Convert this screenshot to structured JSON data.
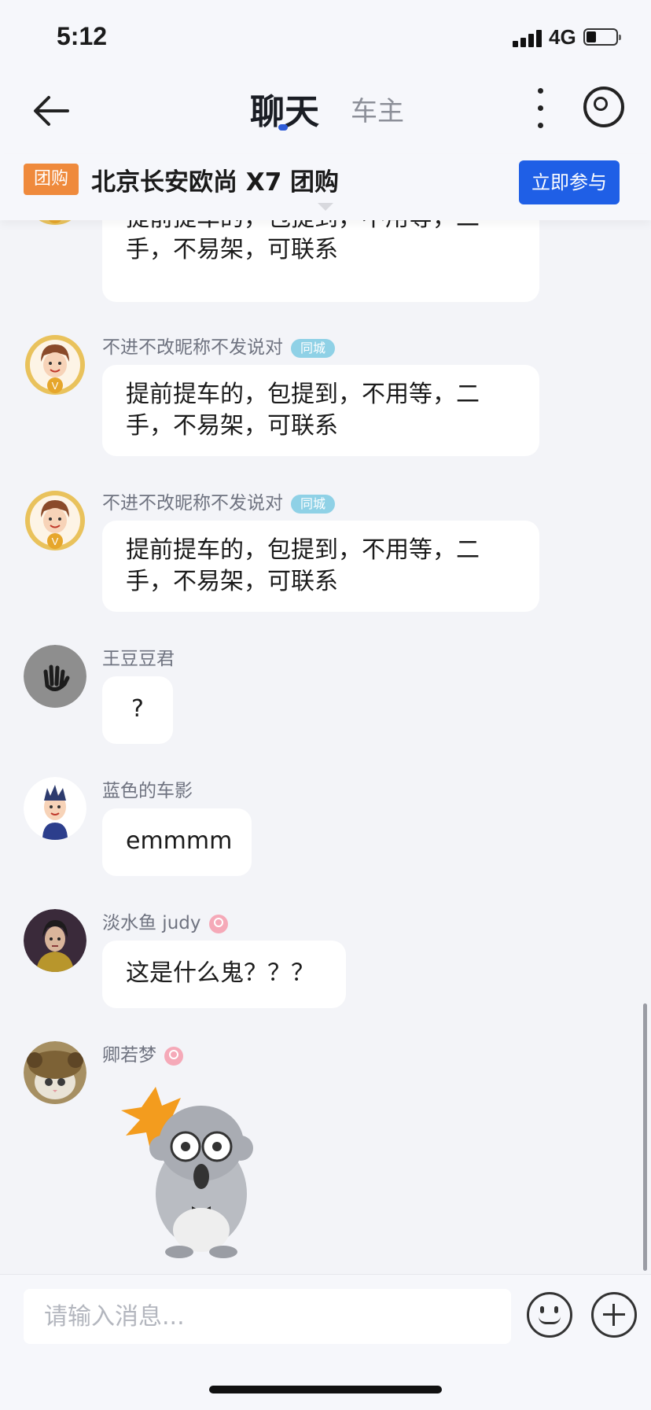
{
  "status_bar": {
    "time": "5:12",
    "network": "4G"
  },
  "nav": {
    "active_tab": "聊天",
    "other_tab": "车主"
  },
  "group_buy": {
    "badge": "团购",
    "title": "北京长安欧尚 X7 团购",
    "join_label": "立即参与"
  },
  "messages": [
    {
      "user": "",
      "tag": "",
      "text_line1": "提前提车的，包提到，不用等，二",
      "text_line2": "手，不易架，可联系"
    },
    {
      "user": "不进不改昵称不发说对",
      "tag": "同城",
      "text_line1": "提前提车的，包提到，不用等，二",
      "text_line2": "手，不易架，可联系"
    },
    {
      "user": "不进不改昵称不发说对",
      "tag": "同城",
      "text_line1": "提前提车的，包提到，不用等，二",
      "text_line2": "手，不易架，可联系"
    },
    {
      "user": "王豆豆君",
      "text": "?"
    },
    {
      "user": "蓝色的车影",
      "text": "emmmm"
    },
    {
      "user": "淡水鱼 judy",
      "text": "这是什么鬼？？？"
    },
    {
      "user": "卿若梦",
      "sticker": "shocked-cartoon-sticker"
    }
  ],
  "input": {
    "placeholder": "请输入消息..."
  },
  "icons": {
    "back": "back-arrow-icon",
    "more": "more-vertical-icon",
    "target": "target-circle-icon",
    "emoji": "smiley-icon",
    "plus": "add-circle-icon"
  },
  "colors": {
    "accent": "#1f5fe6",
    "badge": "#ef8a3c",
    "tag": "#8fd1e6",
    "background": "#f3f4f8"
  }
}
